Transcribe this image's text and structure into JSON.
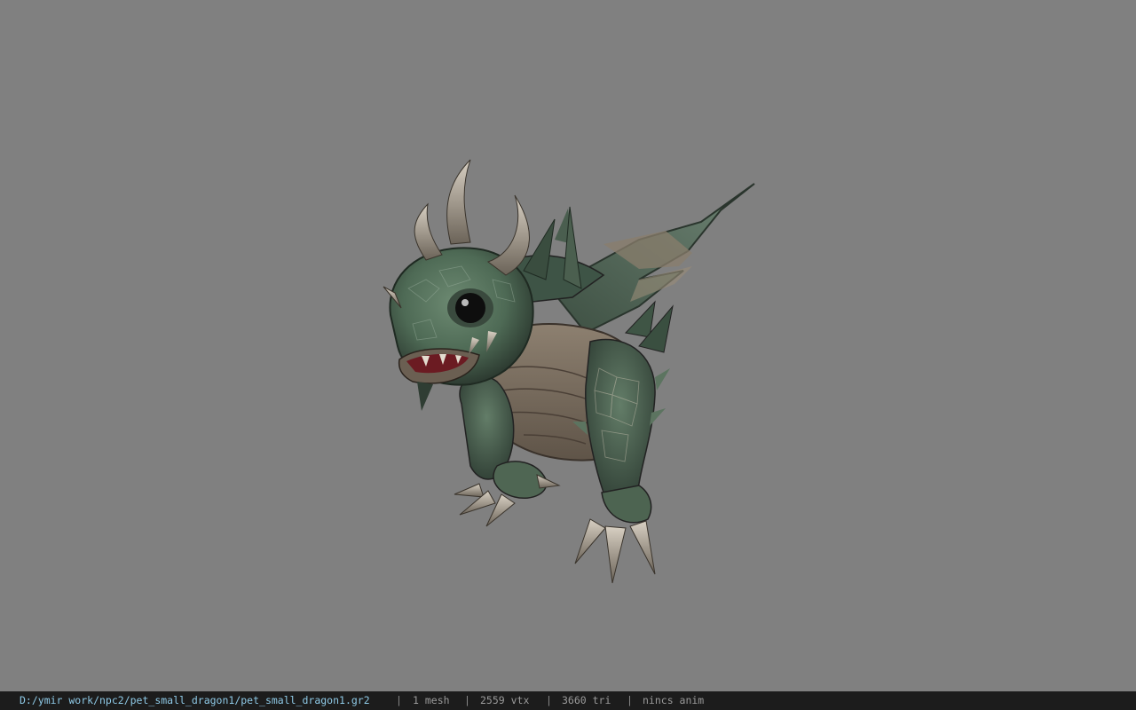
{
  "viewer": {
    "background_color": "#808080",
    "model_subject": "small green dragon pet",
    "colors": {
      "scale_green": "#4e6a55",
      "scale_dark": "#2d3b31",
      "belly_brown": "#7b6e5f",
      "horn_bone": "#b8ad9c",
      "mouth_red": "#6b1b22"
    }
  },
  "status": {
    "file_path": "D:/ymir work/npc2/pet_small_dragon1/pet_small_dragon1.gr2",
    "separator": "|",
    "mesh_count": "1 mesh",
    "vertex_count": "2559 vtx",
    "triangle_count": "3660 tri",
    "animation_file": "nincs anim",
    "bar_color": "#1c1c1c",
    "path_color": "#8ec9e6"
  }
}
